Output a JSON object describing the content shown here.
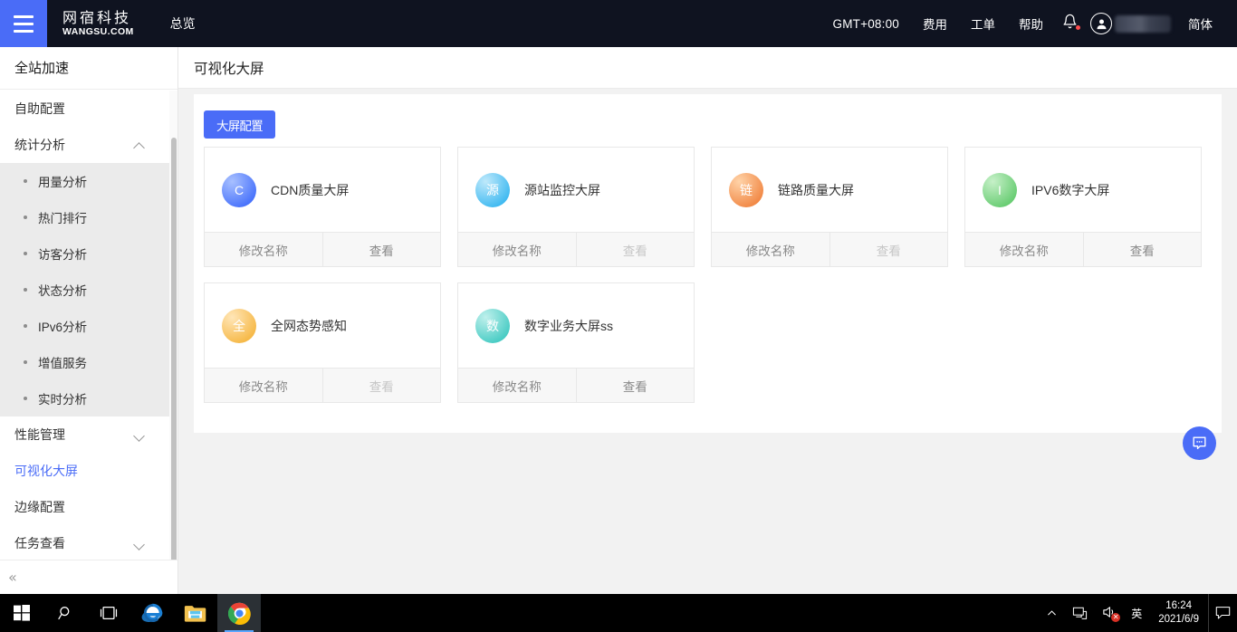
{
  "topbar": {
    "brand_cn": "网宿科技",
    "brand_en": "WANGSU.COM",
    "nav_overview": "总览",
    "timezone": "GMT+08:00",
    "items": [
      {
        "label": "费用"
      },
      {
        "label": "工单"
      },
      {
        "label": "帮助"
      }
    ],
    "language": "简体",
    "bell_icon": "bell-icon",
    "avatar_icon": "user-avatar-icon",
    "username": ""
  },
  "sidebar": {
    "title": "全站加速",
    "collapse_label": "«",
    "menu": [
      {
        "label": "自助配置",
        "type": "single",
        "expandable": false,
        "active": false
      },
      {
        "label": "统计分析",
        "type": "group",
        "expandable": true,
        "expanded": true,
        "children": [
          {
            "label": "用量分析"
          },
          {
            "label": "热门排行"
          },
          {
            "label": "访客分析"
          },
          {
            "label": "状态分析"
          },
          {
            "label": "IPv6分析"
          },
          {
            "label": "增值服务"
          },
          {
            "label": "实时分析"
          }
        ]
      },
      {
        "label": "性能管理",
        "type": "group",
        "expandable": true,
        "expanded": false,
        "children": []
      },
      {
        "label": "可视化大屏",
        "type": "single",
        "expandable": false,
        "active": true
      },
      {
        "label": "边缘配置",
        "type": "single",
        "expandable": false,
        "active": false
      },
      {
        "label": "任务查看",
        "type": "group",
        "expandable": true,
        "expanded": false,
        "children": []
      }
    ]
  },
  "main": {
    "page_title": "可视化大屏",
    "config_button": "大屏配置",
    "action_rename": "修改名称",
    "action_view": "查看",
    "cards": [
      {
        "initial": "C",
        "name": "CDN质量大屏",
        "color_from": "#a8c0ff",
        "color_to": "#3f6bfb",
        "view_enabled": true
      },
      {
        "initial": "源",
        "name": "源站监控大屏",
        "color_from": "#bfe9fb",
        "color_to": "#33b5f0",
        "view_enabled": false
      },
      {
        "initial": "链",
        "name": "链路质量大屏",
        "color_from": "#ffd3a8",
        "color_to": "#f0813c",
        "view_enabled": false
      },
      {
        "initial": "I",
        "name": "IPV6数字大屏",
        "color_from": "#c6f0c8",
        "color_to": "#5fc96a",
        "view_enabled": true
      },
      {
        "initial": "全",
        "name": "全网态势感知",
        "color_from": "#ffe6b8",
        "color_to": "#f5b43c",
        "view_enabled": false
      },
      {
        "initial": "数",
        "name": "数字业务大屏ss",
        "color_from": "#bff0ec",
        "color_to": "#3cc8c0",
        "view_enabled": true
      }
    ],
    "chat_fab_icon": "chat-bubble-icon"
  },
  "taskbar": {
    "buttons": [
      {
        "icon": "windows-start-icon",
        "active": false
      },
      {
        "icon": "search-icon",
        "active": false
      },
      {
        "icon": "task-view-icon",
        "active": false
      },
      {
        "icon": "internet-explorer-icon",
        "active": false
      },
      {
        "icon": "file-explorer-icon",
        "active": false
      },
      {
        "icon": "google-chrome-icon",
        "active": true
      }
    ],
    "tray": {
      "chevron_icon": "chevron-up-icon",
      "network_icon": "network-icon",
      "volume_icon": "volume-muted-icon",
      "ime_label": "英",
      "time": "16:24",
      "date": "2021/6/9",
      "action_center_icon": "action-center-icon"
    }
  },
  "colors": {
    "accent": "#4a6cf7",
    "header_bg": "#0f1320",
    "page_bg": "#f2f2f2",
    "submenu_bg": "#ebebeb",
    "card_footer_bg": "#f7f7f7"
  }
}
